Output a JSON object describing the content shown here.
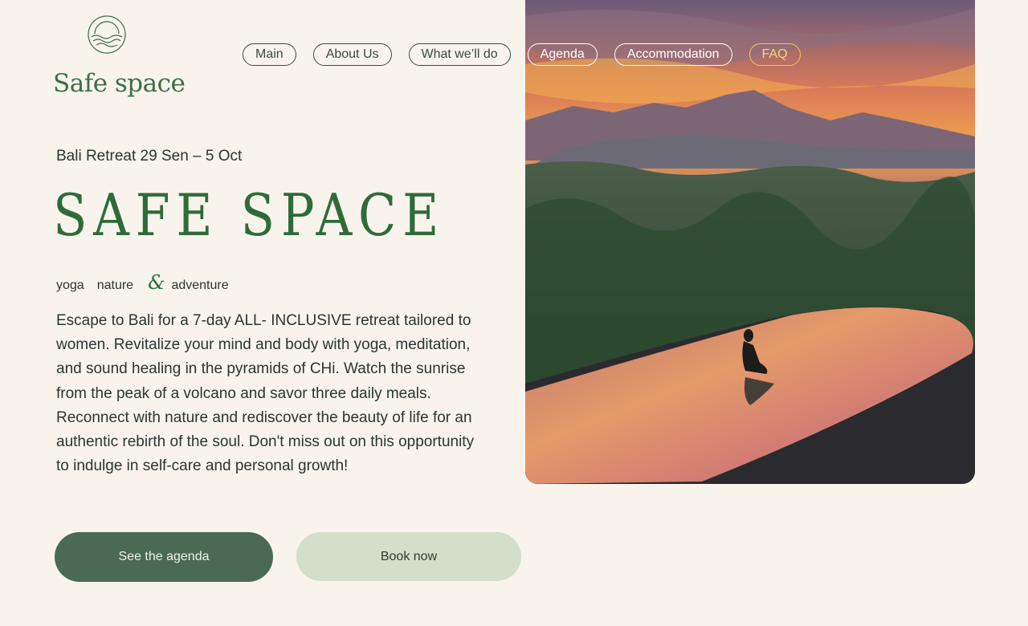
{
  "brand": {
    "name": "Safe space",
    "icon": "sun-waves-logo-icon"
  },
  "nav": {
    "items": [
      "Main",
      "About Us",
      "What we’ll do",
      "Agenda",
      "Accommodation",
      "FAQ"
    ]
  },
  "hero": {
    "dates": "Bali Retreat 29 Sen – 5 Oct",
    "title": "SAFE SPACE",
    "tags": {
      "first": "yoga",
      "second": "nature",
      "amp": "&",
      "third": "adventure"
    },
    "description": "Escape to Bali for a 7-day ALL- INCLUSIVE retreat tailored to women. Revitalize your mind and body with yoga, meditation, and sound healing in the pyramids of CHi. Watch the sunrise from the peak of a volcano and savor three daily meals. Reconnect with nature and rediscover the beauty of life for an authentic rebirth of the soul. Don't miss out on this opportunity to indulge in self-care and personal growth!"
  },
  "actions": {
    "agenda": "See the agenda",
    "book": "Book now"
  },
  "colors": {
    "background": "#f8f4ec",
    "accent": "#2f6b3a",
    "primary_button": "#4b6a53",
    "secondary_button": "#d3dfc9"
  }
}
